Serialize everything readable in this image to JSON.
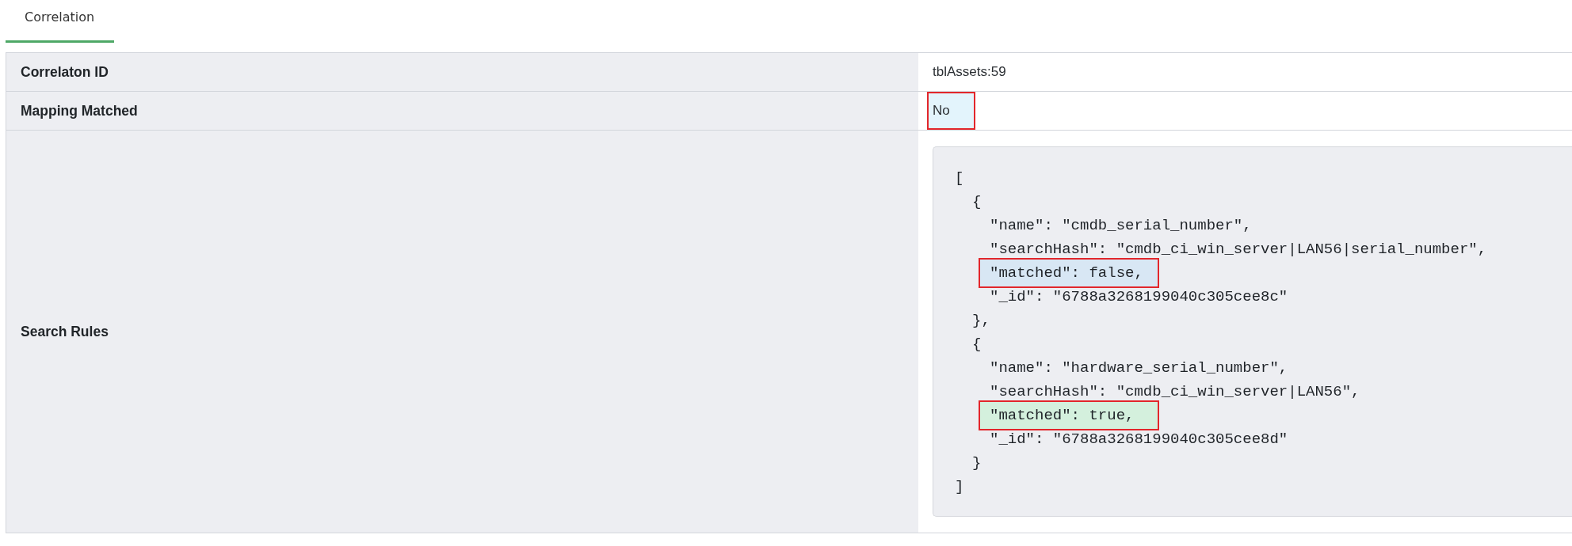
{
  "tabs": [
    {
      "label": "Correlation",
      "selected": true
    }
  ],
  "details": [
    {
      "kind": "text",
      "label": "Correlaton ID",
      "value": "tblAssets:59",
      "highlighted": false
    },
    {
      "kind": "text",
      "label": "Mapping Matched",
      "value": "No",
      "highlighted": true
    },
    {
      "kind": "code",
      "label": "Search Rules",
      "code": [
        {
          "text": "[",
          "highlighted": false,
          "children": [
            {
              "text": "{",
              "highlighted": false,
              "children": [
                {
                  "text": "\"name\": \"cmdb_serial_number\",",
                  "highlighted": false
                },
                {
                  "text": "\"searchHash\": \"cmdb_ci_win_server|LAN56|serial_number\",",
                  "highlighted": false
                },
                {
                  "text": "\"matched\": false,",
                  "highlighted": true,
                  "color": "#d8e7f4"
                },
                {
                  "text": "\"_id\": \"6788a3268199040c305cee8c\"",
                  "highlighted": false
                }
              ]
            },
            {
              "text": "},",
              "highlighted": false
            },
            {
              "text": "{",
              "highlighted": false,
              "children": [
                {
                  "text": "\"name\": \"hardware_serial_number\",",
                  "highlighted": false
                },
                {
                  "text": "\"searchHash\": \"cmdb_ci_win_server|LAN56\",",
                  "highlighted": false
                },
                {
                  "text": "\"matched\": true,",
                  "highlighted": true,
                  "color": "#d4f0dd"
                },
                {
                  "text": "\"_id\": \"6788a3268199040c305cee8d\"",
                  "highlighted": false
                }
              ]
            },
            {
              "text": "}",
              "highlighted": false
            }
          ]
        },
        {
          "text": "]",
          "highlighted": false
        }
      ]
    }
  ]
}
